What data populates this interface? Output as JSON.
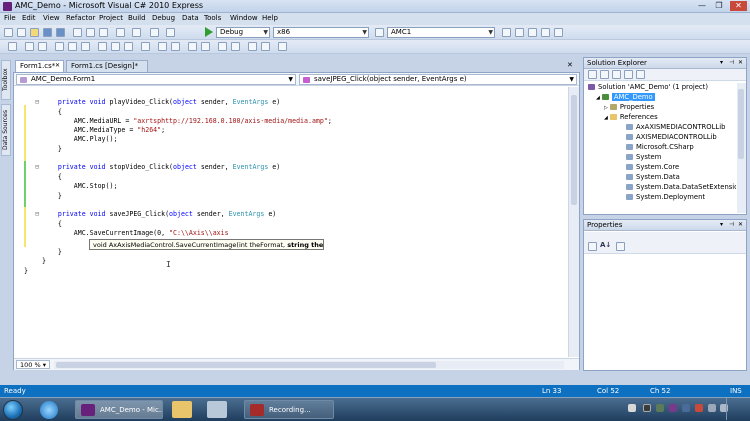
{
  "window": {
    "title": "AMC_Demo - Microsoft Visual C# 2010 Express"
  },
  "menu": [
    "File",
    "Edit",
    "View",
    "Refactor",
    "Project",
    "Build",
    "Debug",
    "Data",
    "Tools",
    "Window",
    "Help"
  ],
  "toolbar": {
    "config": "Debug",
    "platform": "x86",
    "find": "AMC1"
  },
  "sidetabs": [
    "Toolbox",
    "Data Sources"
  ],
  "doc_tabs": [
    {
      "label": "Form1.cs*",
      "active": true
    },
    {
      "label": "Form1.cs [Design]*",
      "active": false
    }
  ],
  "nav": {
    "class": "AMC_Demo.Form1",
    "member": "saveJPEG_Click(object sender, EventArgs e)"
  },
  "code_lines": [
    "    private void playVideo_Click(object sender, EventArgs e)",
    "    {",
    "        AMC.MediaURL = \"axrtsphttp://192.168.0.100/axis-media/media.amp\";",
    "        AMC.MediaType = \"h264\";",
    "        AMC.Play();",
    "    }",
    "",
    "    private void stopVideo_Click(object sender, EventArgs e)",
    "    {",
    "        AMC.Stop();",
    "    }",
    "",
    "    private void saveJPEG_Click(object sender, EventArgs e)",
    "    {",
    "        AMC.SaveCurrentImage(0, \"C:\\\\Axis\\\\axis",
    "",
    "    }",
    "}",
    "}"
  ],
  "tooltip": {
    "prefix": "void AxAxisMediaControl.SaveCurrentImage(int theFormat, ",
    "bold": "string theFile",
    "suffix": ")"
  },
  "zoom": "100 %",
  "solution_explorer": {
    "title": "Solution Explorer",
    "items": [
      {
        "label": "Solution 'AMC_Demo' (1 project)",
        "indent": 0,
        "icon": "sol"
      },
      {
        "label": "AMC_Demo",
        "indent": 1,
        "icon": "proj",
        "selected": true
      },
      {
        "label": "Properties",
        "indent": 2,
        "icon": "prop"
      },
      {
        "label": "References",
        "indent": 2,
        "icon": "folder"
      },
      {
        "label": "AxAXISMEDIACONTROLLib",
        "indent": 3,
        "icon": "ref"
      },
      {
        "label": "AXISMEDIACONTROLLib",
        "indent": 3,
        "icon": "ref"
      },
      {
        "label": "Microsoft.CSharp",
        "indent": 3,
        "icon": "ref"
      },
      {
        "label": "System",
        "indent": 3,
        "icon": "ref"
      },
      {
        "label": "System.Core",
        "indent": 3,
        "icon": "ref"
      },
      {
        "label": "System.Data",
        "indent": 3,
        "icon": "ref"
      },
      {
        "label": "System.Data.DataSetExtensions",
        "indent": 3,
        "icon": "ref"
      },
      {
        "label": "System.Deployment",
        "indent": 3,
        "icon": "ref"
      }
    ]
  },
  "properties": {
    "title": "Properties"
  },
  "status": {
    "ready": "Ready",
    "ln": "Ln 33",
    "col": "Col 52",
    "ch": "Ch 52",
    "ins": "INS"
  },
  "taskbar": {
    "tasks": [
      "AMC_Demo - Mic...",
      "Recording..."
    ]
  },
  "colors": {
    "status_blue": "#0e70c0",
    "keyword": "#0000ff",
    "type": "#2b91af",
    "string": "#a31515"
  }
}
